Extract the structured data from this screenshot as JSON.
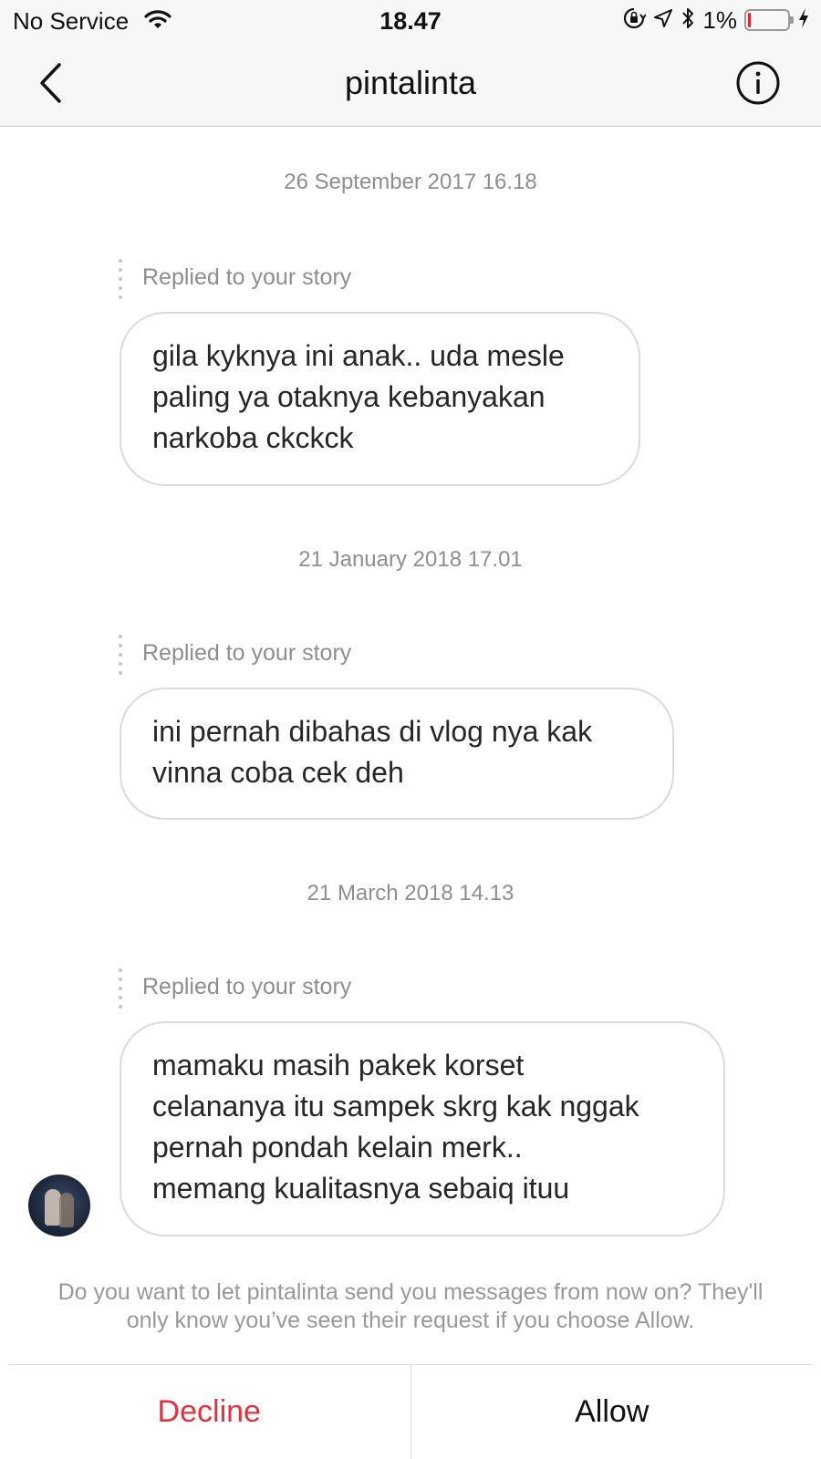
{
  "status_bar": {
    "carrier": "No Service",
    "time": "18.47",
    "battery_percent_label": "1%",
    "battery_level": 0.01,
    "icons": [
      "wifi-icon",
      "orientation-lock-icon",
      "location-icon",
      "bluetooth-icon",
      "battery-icon",
      "charging-icon"
    ],
    "battery_low_color": "#e0252f"
  },
  "nav": {
    "title": "pintalinta",
    "back_icon": "chevron-left-icon",
    "info_icon": "info-icon"
  },
  "messages": [
    {
      "timestamp": "26 September 2017 16.18",
      "reply_label": "Replied to your story",
      "lines": [
        "gila kyknya ini anak.. uda mesle",
        "paling ya otaknya kebanyakan",
        "narkoba ckckck"
      ]
    },
    {
      "timestamp": "21 January 2018 17.01",
      "reply_label": "Replied to your story",
      "lines": [
        "ini pernah dibahas di vlog nya kak",
        "vinna coba cek deh"
      ]
    },
    {
      "timestamp": "21 March 2018 14.13",
      "reply_label": "Replied to your story",
      "lines": [
        "mamaku masih pakek korset",
        "celananya itu sampek skrg kak nggak",
        "pernah pondah kelain merk..",
        "memang kualitasnya sebaiq ituu"
      ]
    }
  ],
  "request": {
    "line1": "Do you want to let pintalinta send you messages from now on? They'll",
    "line2": "only know you’ve seen their request if you choose Allow.",
    "decline_label": "Decline",
    "allow_label": "Allow",
    "decline_color": "#e0333e"
  }
}
